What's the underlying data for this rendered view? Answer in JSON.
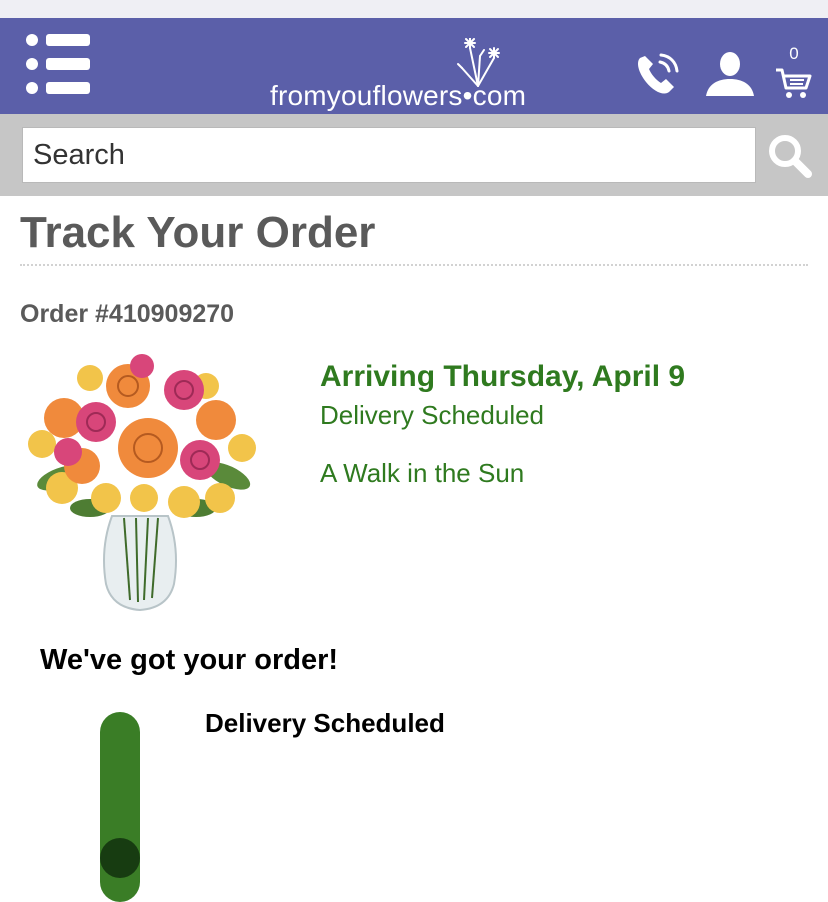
{
  "header": {
    "brand": "fromyouflowers•com",
    "cart_count": "0",
    "icons": [
      "menu-icon",
      "flower-logo-icon",
      "phone-icon",
      "user-icon",
      "cart-icon"
    ],
    "background_color": "#5b5fa9"
  },
  "search": {
    "placeholder": "Search",
    "icon": "search-icon"
  },
  "page": {
    "title": "Track Your Order",
    "order_number": "Order #410909270"
  },
  "order": {
    "arriving": "Arriving Thursday, April 9",
    "status": "Delivery Scheduled",
    "product_name": "A Walk in the Sun",
    "accent_color": "#2f7a1f"
  },
  "tracking": {
    "heading": "We've got your order!",
    "current_step": "Delivery Scheduled",
    "bar_color": "#3a7d26"
  }
}
